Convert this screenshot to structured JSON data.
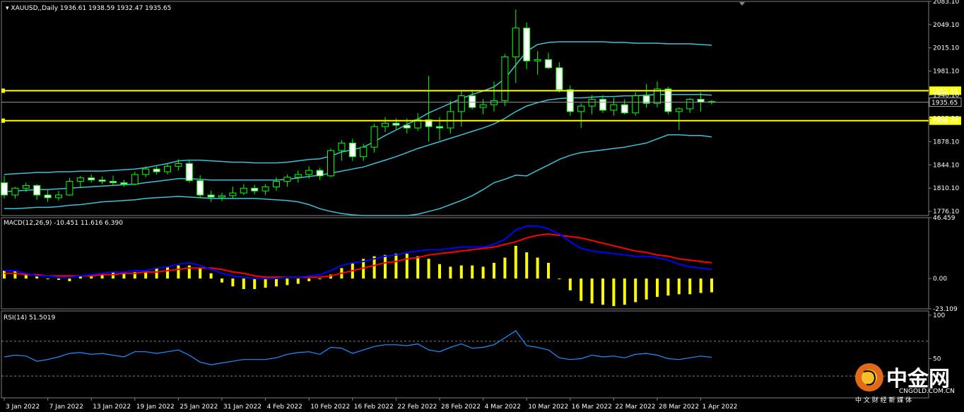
{
  "chart_data": {
    "type": "candlestick",
    "symbol_header": "XAUUSD,,Daily",
    "ohlc_header": "1936.61 1938.59 1932.47 1935.65",
    "main": {
      "ylim": [
        1770,
        2083
      ],
      "y_ticks": [
        "2083.10",
        "2049.10",
        "2015.10",
        "1981.10",
        "1946.10",
        "1912.10",
        "1878.10",
        "1844.10",
        "1810.10",
        "1776.10"
      ],
      "y_tick_values": [
        2083.1,
        2049.1,
        2015.1,
        1981.1,
        1946.1,
        1912.1,
        1878.1,
        1844.1,
        1810.1,
        1776.1
      ],
      "current_price": "1935.65",
      "current_price_value": 1935.65,
      "levels": [
        {
          "label": "1952.49",
          "value": 1952.49,
          "color": "#ffff00"
        },
        {
          "label": "1908.70",
          "value": 1908.7,
          "color": "#ffff00"
        }
      ],
      "candles": [
        [
          1818,
          1828,
          1795,
          1800
        ],
        [
          1800,
          1812,
          1795,
          1810
        ],
        [
          1810,
          1818,
          1804,
          1814
        ],
        [
          1814,
          1816,
          1793,
          1800
        ],
        [
          1800,
          1808,
          1790,
          1796
        ],
        [
          1796,
          1806,
          1792,
          1800
        ],
        [
          1800,
          1825,
          1799,
          1820
        ],
        [
          1820,
          1828,
          1810,
          1825
        ],
        [
          1825,
          1830,
          1818,
          1822
        ],
        [
          1822,
          1827,
          1816,
          1820
        ],
        [
          1820,
          1828,
          1814,
          1818
        ],
        [
          1818,
          1822,
          1812,
          1816
        ],
        [
          1816,
          1834,
          1814,
          1830
        ],
        [
          1830,
          1842,
          1826,
          1838
        ],
        [
          1838,
          1842,
          1830,
          1834
        ],
        [
          1834,
          1846,
          1830,
          1842
        ],
        [
          1842,
          1852,
          1836,
          1846
        ],
        [
          1846,
          1850,
          1818,
          1821
        ],
        [
          1821,
          1829,
          1796,
          1800
        ],
        [
          1800,
          1806,
          1790,
          1797
        ],
        [
          1797,
          1803,
          1791,
          1799
        ],
        [
          1799,
          1812,
          1795,
          1803
        ],
        [
          1803,
          1816,
          1800,
          1810
        ],
        [
          1810,
          1815,
          1801,
          1806
        ],
        [
          1806,
          1816,
          1800,
          1812
        ],
        [
          1812,
          1826,
          1806,
          1820
        ],
        [
          1820,
          1830,
          1812,
          1826
        ],
        [
          1826,
          1836,
          1818,
          1830
        ],
        [
          1830,
          1842,
          1824,
          1836
        ],
        [
          1836,
          1840,
          1822,
          1828
        ],
        [
          1828,
          1868,
          1826,
          1865
        ],
        [
          1865,
          1880,
          1850,
          1876
        ],
        [
          1876,
          1882,
          1850,
          1856
        ],
        [
          1856,
          1875,
          1850,
          1870
        ],
        [
          1870,
          1904,
          1862,
          1900
        ],
        [
          1900,
          1914,
          1892,
          1905
        ],
        [
          1905,
          1912,
          1896,
          1902
        ],
        [
          1902,
          1912,
          1890,
          1898
        ],
        [
          1898,
          1920,
          1894,
          1910
        ],
        [
          1910,
          1974,
          1878,
          1900
        ],
        [
          1900,
          1914,
          1880,
          1898
        ],
        [
          1898,
          1938,
          1890,
          1922
        ],
        [
          1922,
          1952,
          1900,
          1945
        ],
        [
          1945,
          1954,
          1925,
          1928
        ],
        [
          1928,
          1940,
          1918,
          1932
        ],
        [
          1932,
          1966,
          1922,
          1938
        ],
        [
          1938,
          2006,
          1930,
          2002
        ],
        [
          2002,
          2071,
          1964,
          2044
        ],
        [
          2044,
          2052,
          1984,
          1996
        ],
        [
          1996,
          2010,
          1976,
          1998
        ],
        [
          1998,
          2008,
          1984,
          1986
        ],
        [
          1986,
          1994,
          1950,
          1954
        ],
        [
          1954,
          1960,
          1916,
          1922
        ],
        [
          1922,
          1934,
          1898,
          1930
        ],
        [
          1930,
          1946,
          1918,
          1940
        ],
        [
          1940,
          1946,
          1920,
          1924
        ],
        [
          1924,
          1942,
          1916,
          1932
        ],
        [
          1932,
          1940,
          1918,
          1920
        ],
        [
          1920,
          1950,
          1916,
          1945
        ],
        [
          1945,
          1962,
          1928,
          1934
        ],
        [
          1934,
          1966,
          1928,
          1955
        ],
        [
          1955,
          1958,
          1918,
          1922
        ],
        [
          1922,
          1928,
          1895,
          1926
        ],
        [
          1926,
          1942,
          1920,
          1940
        ],
        [
          1940,
          1950,
          1922,
          1936
        ],
        [
          1936.61,
          1938.59,
          1932.47,
          1935.65
        ]
      ],
      "bb_upper": [
        1830,
        1831,
        1832,
        1833,
        1833,
        1834,
        1834,
        1835,
        1835,
        1835,
        1836,
        1837,
        1838,
        1840,
        1843,
        1846,
        1850,
        1851,
        1851,
        1850,
        1849,
        1848,
        1848,
        1847,
        1847,
        1847,
        1848,
        1850,
        1852,
        1853,
        1857,
        1863,
        1866,
        1870,
        1878,
        1887,
        1895,
        1903,
        1911,
        1920,
        1927,
        1934,
        1941,
        1947,
        1952,
        1958,
        1970,
        1990,
        2010,
        2020,
        2023,
        2024,
        2024,
        2024,
        2024,
        2024,
        2023,
        2023,
        2022,
        2022,
        2022,
        2021,
        2021,
        2021,
        2020,
        2019
      ],
      "bb_middle": [
        1805,
        1806,
        1807,
        1808,
        1808,
        1809,
        1810,
        1811,
        1812,
        1813,
        1814,
        1815,
        1816,
        1818,
        1820,
        1822,
        1824,
        1824,
        1823,
        1822,
        1822,
        1822,
        1822,
        1822,
        1822,
        1822,
        1823,
        1825,
        1827,
        1829,
        1832,
        1835,
        1838,
        1841,
        1846,
        1851,
        1856,
        1862,
        1868,
        1873,
        1878,
        1883,
        1888,
        1893,
        1898,
        1904,
        1912,
        1922,
        1930,
        1935,
        1939,
        1941,
        1942,
        1942,
        1943,
        1944,
        1944,
        1945,
        1945,
        1946,
        1947,
        1947,
        1947,
        1947,
        1947,
        1946
      ],
      "bb_lower": [
        1780,
        1780,
        1781,
        1782,
        1782,
        1783,
        1785,
        1786,
        1788,
        1790,
        1791,
        1792,
        1793,
        1795,
        1796,
        1797,
        1798,
        1797,
        1796,
        1795,
        1795,
        1795,
        1795,
        1795,
        1794,
        1793,
        1792,
        1790,
        1786,
        1780,
        1776,
        1773,
        1771,
        1768,
        1766,
        1766,
        1766,
        1768,
        1772,
        1776,
        1780,
        1786,
        1792,
        1799,
        1808,
        1818,
        1823,
        1829,
        1828,
        1836,
        1844,
        1852,
        1858,
        1862,
        1864,
        1866,
        1868,
        1870,
        1873,
        1876,
        1882,
        1888,
        1888,
        1887,
        1887,
        1885
      ]
    },
    "macd": {
      "header": "MACD(12,26,9) -10.451 11.616 6.390",
      "ylim": [
        -23.109,
        46.459
      ],
      "y_ticks": [
        "46.459",
        "0.00",
        "-23.109"
      ],
      "y_tick_values": [
        46.459,
        0,
        -23.109
      ],
      "histogram": [
        6,
        6,
        4,
        2,
        0,
        -1,
        -2,
        2,
        3,
        4,
        5,
        5,
        5,
        6,
        8,
        9,
        10,
        10,
        8,
        4,
        -3,
        -6,
        -8,
        -8,
        -7,
        -6,
        -5,
        -4,
        -2,
        0,
        3,
        8,
        12,
        15,
        17,
        18,
        19,
        19,
        17,
        15,
        11,
        9,
        10,
        10,
        9,
        12,
        16,
        25,
        20,
        16,
        12,
        0,
        -9,
        -17,
        -19,
        -20,
        -21,
        -20,
        -18,
        -16,
        -14,
        -13,
        -12,
        -12,
        -11,
        -10.5
      ],
      "macd_line": [
        6,
        6,
        4,
        2,
        2,
        1,
        1,
        2,
        3,
        4,
        5,
        5,
        6,
        6,
        8,
        9,
        11,
        12,
        10,
        7,
        4,
        2,
        1,
        0,
        0,
        0,
        1,
        1,
        2,
        3,
        6,
        10,
        12,
        13,
        15,
        17,
        18,
        20,
        21,
        22,
        22,
        23,
        24,
        24,
        24,
        26,
        30,
        37,
        40,
        40,
        38,
        34,
        28,
        23,
        21,
        20,
        19,
        18,
        17,
        17,
        16,
        14,
        11,
        9,
        8,
        7
      ],
      "signal_line": [
        4,
        4,
        3,
        3,
        2,
        2,
        2,
        2,
        2,
        3,
        3,
        4,
        4,
        5,
        5,
        6,
        7,
        8,
        8,
        8,
        7,
        5,
        4,
        2,
        1,
        1,
        1,
        1,
        1,
        1,
        2,
        4,
        6,
        8,
        10,
        12,
        13,
        15,
        16,
        18,
        19,
        20,
        21,
        22,
        23,
        24,
        26,
        28,
        31,
        33,
        34,
        33,
        32,
        31,
        29,
        27,
        25,
        23,
        21,
        20,
        18,
        17,
        15,
        14,
        13,
        12
      ]
    },
    "rsi": {
      "header": "RSI(14) 51.5019",
      "ylim": [
        0,
        100
      ],
      "y_ticks": [
        "100",
        "50"
      ],
      "y_tick_values": [
        100,
        50
      ],
      "levels": [
        70,
        30
      ],
      "values": [
        52,
        54,
        53,
        47,
        49,
        52,
        56,
        57,
        55,
        56,
        54,
        52,
        58,
        58,
        56,
        58,
        60,
        54,
        46,
        43,
        45,
        47,
        49,
        49,
        49,
        51,
        55,
        57,
        58,
        55,
        63,
        62,
        56,
        60,
        64,
        66,
        66,
        65,
        67,
        60,
        58,
        63,
        67,
        62,
        63,
        66,
        74,
        82,
        65,
        63,
        60,
        51,
        49,
        50,
        54,
        52,
        53,
        51,
        55,
        56,
        54,
        50,
        49,
        51,
        53,
        51.5
      ]
    },
    "x_labels": [
      "3 Jan 2022",
      "7 Jan 2022",
      "13 Jan 2022",
      "19 Jan 2022",
      "25 Jan 2022",
      "31 Jan 2022",
      "4 Feb 2022",
      "10 Feb 2022",
      "16 Feb 2022",
      "22 Feb 2022",
      "28 Feb 2022",
      "4 Mar 2022",
      "10 Mar 2022",
      "16 Mar 2022",
      "22 Mar 2022",
      "28 Mar 2022",
      "1 Apr 2022"
    ],
    "x_label_index": [
      0,
      4,
      8,
      12,
      16,
      20,
      24,
      28,
      32,
      36,
      40,
      44,
      48,
      52,
      56,
      60,
      64
    ],
    "colors": {
      "background": "#000000",
      "bull_candle": "#00ff00",
      "bear_candle_fill": "#ffffff",
      "bollinger": "#40c0d0",
      "level_line": "#ffff00",
      "macd_line": "#0000ff",
      "signal_line": "#ff0000",
      "histogram": "#ffff00",
      "rsi_line": "#1e90ff",
      "grid": "#808080"
    }
  },
  "watermark": {
    "brand": "中金网",
    "site": "CNGOLD.COM.CN",
    "slogan": "中 文 财 经 新 媒 体"
  }
}
